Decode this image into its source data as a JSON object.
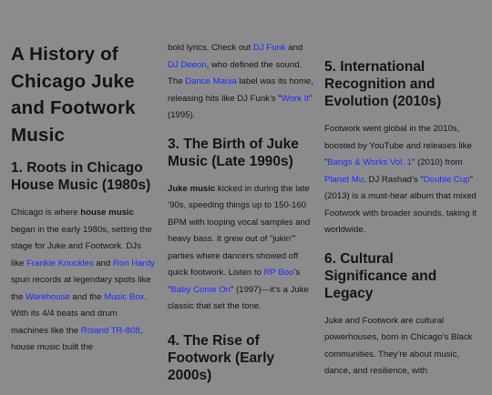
{
  "article": {
    "title": "A History of Chicago Juke and Footwork Music",
    "sections": {
      "s1": {
        "heading": "1. Roots in Chicago House Music (1980s)",
        "t1": "Chicago is where ",
        "b1": "house music",
        "t2": " began in the early 1980s, setting the stage for Juke and Footwork. DJs like ",
        "l1": "Frankie Knuckles",
        "t3": " and ",
        "l2": "Ron Hardy",
        "t4": " spun records at legendary spots like the ",
        "l3": "Warehouse",
        "t5": " and the ",
        "l4": "Music Box",
        "t6": ". With its 4/4 beats and drum machines like the ",
        "l5": "Roland TR-808",
        "t7": ", house music built the"
      },
      "s2": {
        "p0_t1": "bold lyrics. Check out ",
        "p0_l1": "DJ Funk",
        "p0_t2": " and ",
        "p0_l2": "DJ Deeon",
        "p0_t3": ", who defined the sound. The ",
        "p0_l3": "Dance Mania",
        "p0_t4": " label was its home, releasing hits like DJ Funk’s \"",
        "p0_l4": "Work It",
        "p0_t5": "\" (1995).",
        "heading": "3. The Birth of Juke Music (Late 1990s)",
        "b1": "Juke music",
        "t1": " kicked in during the late ’90s, speeding things up to 150-160 BPM with looping vocal samples and heavy bass. It grew out of \"jukin’\" parties where dancers showed off quick footwork. Listen to ",
        "l1": "RP Boo",
        "t2": "’s \"",
        "l2": "Baby Come On",
        "t3": "\" (1997)—it’s a Juke classic that set the tone."
      },
      "s2b": {
        "heading": "4. The Rise of Footwork (Early 2000s)"
      },
      "s3": {
        "heading": "5. International Recognition and Evolution (2010s)",
        "t1": "Footwork went global in the 2010s, boosted by YouTube and releases like \"",
        "l1": "Bangs & Works Vol. 1",
        "t2": "\" (2010) from ",
        "l2": "Planet Mu",
        "t3": ". DJ Rashad’s \"",
        "l3": "Double Cup",
        "t4": "\" (2013) is a must-hear album that mixed Footwork with broader sounds, taking it worldwide."
      },
      "s4": {
        "heading": "6. Cultural Significance and Legacy",
        "t1": "Juke and Footwork are cultural powerhouses, born in Chicago’s Black communities. They’re about music, dance, and resilience, with"
      }
    }
  }
}
